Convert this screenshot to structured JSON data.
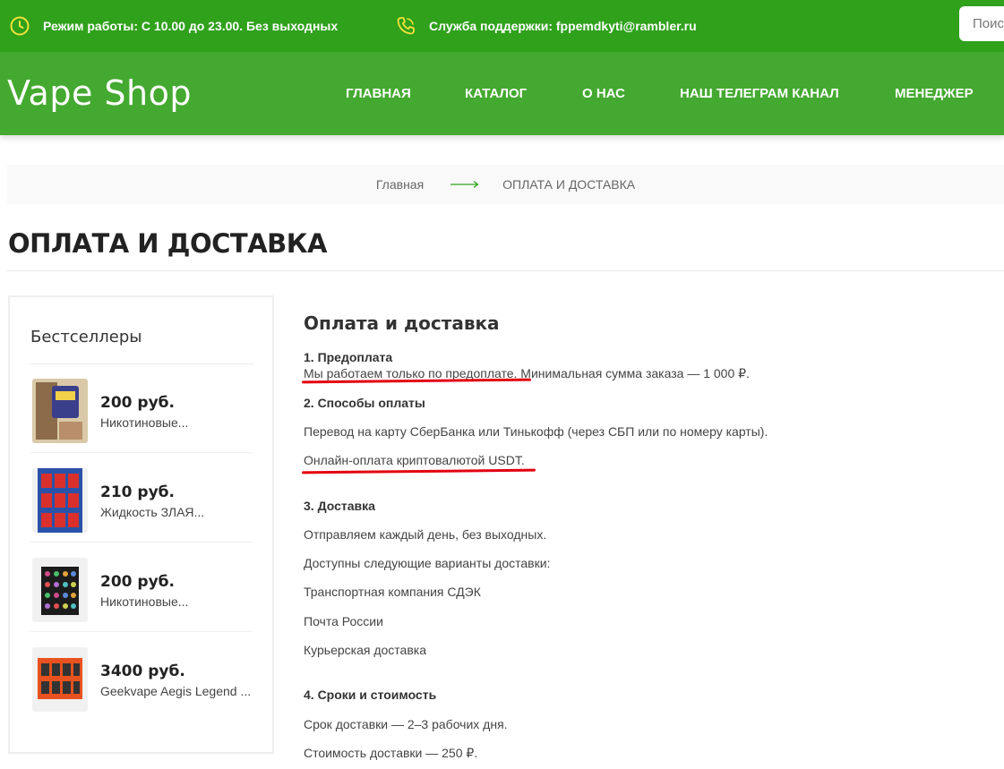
{
  "topbar": {
    "hours_text": "Режим работы: С 10.00 до 23.00. Без выходных",
    "support_text": "Служба поддержки: fppemdkyti@rambler.ru",
    "search_placeholder": "Поиск"
  },
  "header": {
    "logo": "Vape Shop",
    "nav": [
      "ГЛАВНАЯ",
      "КАТАЛОГ",
      "О НАС",
      "НАШ ТЕЛЕГРАМ КАНАЛ",
      "МЕНЕДЖЕР"
    ]
  },
  "breadcrumb": {
    "home": "Главная",
    "current": "ОПЛАТА И ДОСТАВКА"
  },
  "page_title": "ОПЛАТА И ДОСТАВКА",
  "sidebar": {
    "title": "Бестселлеры",
    "products": [
      {
        "price": "200 руб.",
        "name": "Никотиновые..."
      },
      {
        "price": "210 руб.",
        "name": "Жидкость ЗЛАЯ..."
      },
      {
        "price": "200 руб.",
        "name": "Никотиновые..."
      },
      {
        "price": "3400 руб.",
        "name": "Geekvape Aegis Legend ..."
      }
    ]
  },
  "content": {
    "title": "Оплата и доставка",
    "s1_heading": "1. Предоплата",
    "s1_text": "Мы работаем только по предоплате. Минимальная сумма заказа — 1 000 ₽.",
    "s2_heading": "2. Способы оплаты",
    "s2_line1": "Перевод на карту СберБанка или Тинькофф (через СБП или по номеру карты).",
    "s2_line2": "Онлайн-оплата криптовалютой USDT.",
    "s3_heading": "3. Доставка",
    "s3_line1": "Отправляем каждый день, без выходных.",
    "s3_line2": "Доступны следующие варианты доставки:",
    "s3_line3": "Транспортная компания СДЭК",
    "s3_line4": "Почта России",
    "s3_line5": "Курьерская доставка",
    "s4_heading": "4. Сроки и стоимость",
    "s4_line1": "Срок доставки — 2–3 рабочих дня.",
    "s4_line2": "Стоимость доставки — 250 ₽."
  },
  "colors": {
    "topbar_green": "#2fa11b",
    "header_green": "#44a930",
    "icon_yellow": "#f5e13a",
    "annotation_red": "#e3000f"
  }
}
